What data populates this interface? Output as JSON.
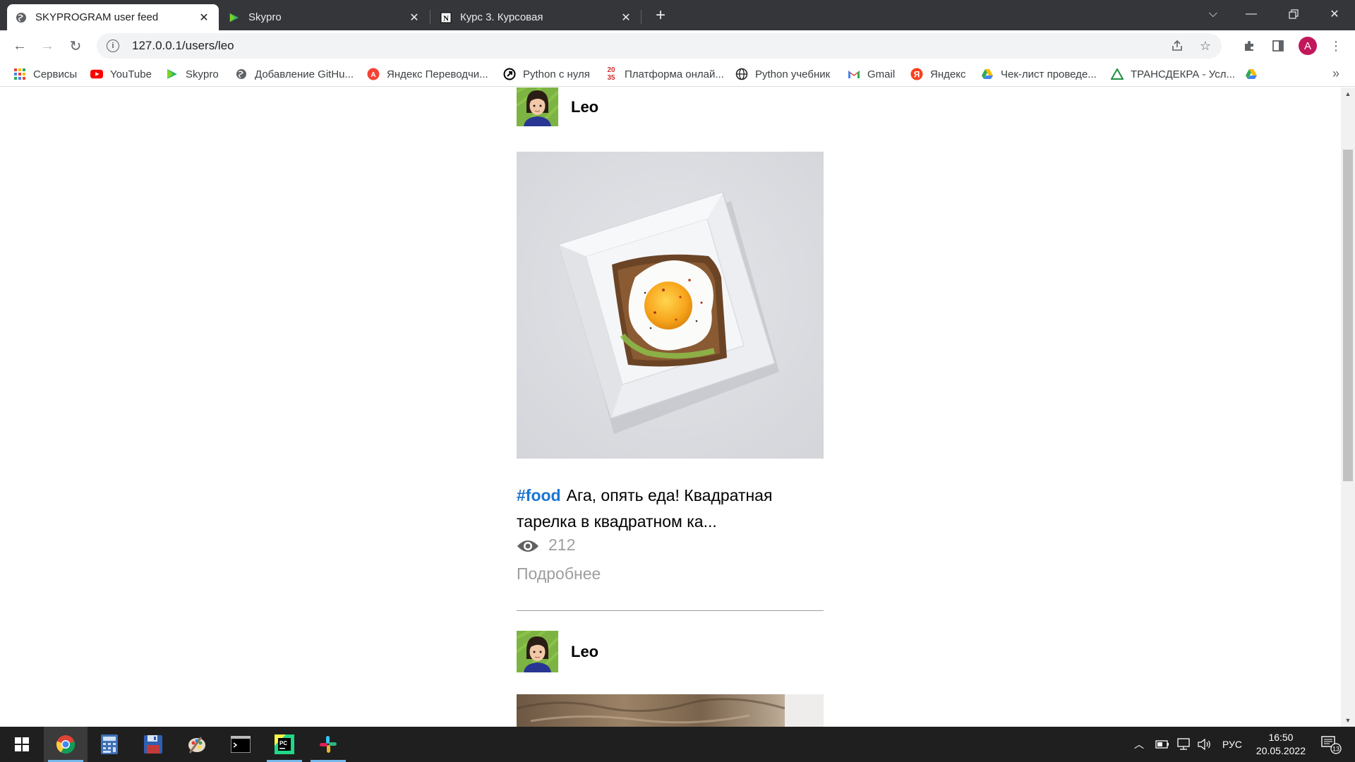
{
  "browser": {
    "tabs": [
      {
        "title": "SKYPROGRAM user feed",
        "favicon": "globe-icon",
        "active": true
      },
      {
        "title": "Skypro",
        "favicon": "skypro-play-icon",
        "active": false
      },
      {
        "title": "Курс 3. Курсовая",
        "favicon": "notion-icon",
        "active": false
      }
    ],
    "address": "127.0.0.1/users/leo",
    "profile_initial": "A"
  },
  "bookmarks": [
    {
      "label": "Сервисы",
      "icon": "apps-grid-icon"
    },
    {
      "label": "YouTube",
      "icon": "youtube-icon"
    },
    {
      "label": "Skypro",
      "icon": "skypro-play-icon"
    },
    {
      "label": "Добавление GitHu...",
      "icon": "globe-icon"
    },
    {
      "label": "Яндекс Переводчи...",
      "icon": "translate-icon"
    },
    {
      "label": "Python с нуля",
      "icon": "python-site-icon"
    },
    {
      "label": "Платформа онлай...",
      "icon": "platform-icon"
    },
    {
      "label": "Python учебник",
      "icon": "globe-icon"
    },
    {
      "label": "Gmail",
      "icon": "gmail-icon"
    },
    {
      "label": "Яндекс",
      "icon": "yandex-icon"
    },
    {
      "label": "Чек-лист проведе...",
      "icon": "google-drive-icon"
    },
    {
      "label": "ТРАНСДЕКРА - Усл...",
      "icon": "google-drive-icon"
    },
    {
      "label": "",
      "icon": "google-drive-icon"
    }
  ],
  "posts": [
    {
      "user": "Leo",
      "photo": "egg-toast-on-square-plate",
      "tag": "#food",
      "text": "Ага, опять еда! Квадратная тарелка в квадратном ка...",
      "views": "212",
      "more_label": "Подробнее"
    },
    {
      "user": "Leo",
      "photo": "cat-photo"
    }
  ],
  "taskbar": {
    "apps": [
      "windows-start-icon",
      "chrome-icon",
      "calculator-icon",
      "save-floppy-icon",
      "paint-icon",
      "terminal-icon",
      "pycharm-icon",
      "slack-icon"
    ],
    "language": "РУС",
    "time": "16:50",
    "date": "20.05.2022",
    "notifications": "13"
  },
  "colors": {
    "accent_tag": "#1976d2",
    "muted": "#9e9e9e",
    "tabstrip": "#35363a",
    "taskbar": "#1f1f1f"
  }
}
